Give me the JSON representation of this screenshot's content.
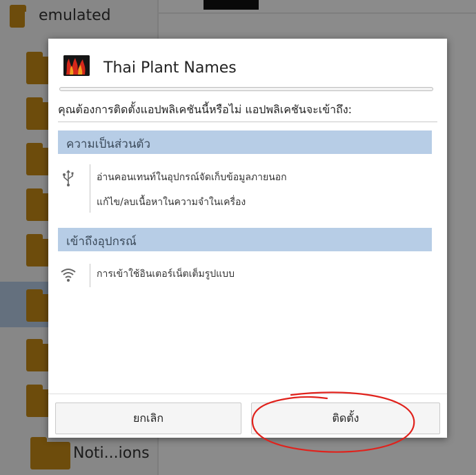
{
  "background": {
    "folder_top_label": "emulated",
    "folder_bottom_label": "Noti...ions"
  },
  "dialog": {
    "title": "Thai Plant Names",
    "question": "คุณต้องการติดตั้งแอปพลิเคชันนี้หรือไม่ แอปพลิเคชันจะเข้าถึง:",
    "sections": [
      {
        "header": "ความเป็นส่วนตัว",
        "icon": "usb-icon",
        "permissions": [
          "อ่านคอนเทนท์ในอุปกรณ์จัดเก็บข้อมูลภายนอก",
          "แก้ไข/ลบเนื้อหาในความจำในเครื่อง"
        ]
      },
      {
        "header": "เข้าถึงอุปกรณ์",
        "icon": "wifi-icon",
        "permissions": [
          "การเข้าใช้อินเตอร์เน็ตเต็มรูปแบบ"
        ]
      }
    ],
    "buttons": {
      "cancel": "ยกเลิก",
      "install": "ติดตั้ง"
    }
  },
  "colors": {
    "section_header_bg": "#b7cde6",
    "annotation_circle": "#e0221c",
    "folder": "#c68b16"
  }
}
